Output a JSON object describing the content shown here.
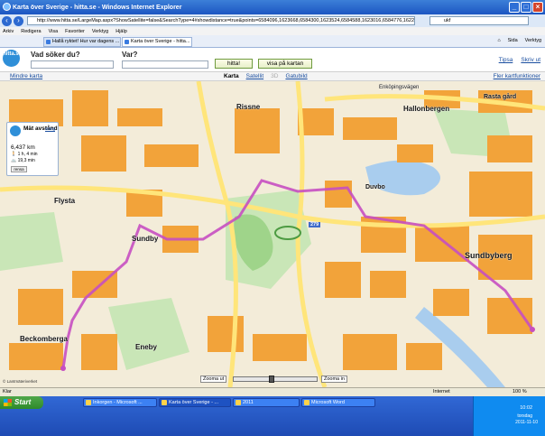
{
  "window": {
    "title": "Karta över Sverige - hitta.se - Windows Internet Explorer",
    "min": "_",
    "max": "□",
    "close": "×"
  },
  "address": {
    "url": "http://www.hitta.se/LargeMap.aspx?ShowSatellite=false&SearchType=4#showdistance=true&points=6584096,1623668,6584300,1623524,6584588,1623016,6584776,1622800",
    "search": "ukf"
  },
  "menu": [
    "Arkiv",
    "Redigera",
    "Visa",
    "Favoriter",
    "Verktyg",
    "Hjälp"
  ],
  "tabs": [
    "Hallå ryktet! Hur var dagens ...",
    "Karta över Sverige - hitta..."
  ],
  "commands": [
    "Sida",
    "Verktyg"
  ],
  "site": {
    "logo": "hitta.se",
    "what_label": "Vad söker du?",
    "where_label": "Var?",
    "search_button": "hitta!",
    "map_button": "visa på kartan",
    "links": [
      "Tipsa",
      "Skriv ut"
    ]
  },
  "maptoolbar": {
    "smaller": "Mindre karta",
    "tabs": [
      "Karta",
      "Satellit",
      "3D",
      "Gatubild"
    ],
    "more": "Fler kartfunktioner"
  },
  "distance_panel": {
    "title": "Mät avstånd",
    "close": "stäng",
    "km": "6,437 km",
    "walk": "1 h, 4 min",
    "bike": "19,3 min",
    "clear": "rensa"
  },
  "map_labels": {
    "rissne": "Rissne",
    "hallonbergen": "Hallonbergen",
    "sundbyberg": "Sundbyberg",
    "sundby": "Sundby",
    "flysta": "Flysta",
    "beckomberga": "Beckomberga",
    "eneby": "Eneby",
    "duvbo": "Duvbo",
    "rasta_gard": "Rasta gård",
    "enkopingsvagen": "Enköpingsvägen",
    "road_number": "279",
    "copyright": "© Lantmäteriverket"
  },
  "zoom": {
    "out": "Zooma ut",
    "in": "Zooma in",
    "level": 0.45
  },
  "status": {
    "ready": "Klar",
    "zone": "Internet",
    "zoom": "100 %"
  },
  "taskbar": {
    "start": "Start",
    "tasks": [
      "Inkorgen - Microsoft ...",
      "Karta över Sverige - ...",
      "2011",
      "Microsoft Word"
    ],
    "time": "10:02",
    "day": "torsdag",
    "date": "2011-11-10"
  },
  "colors": {
    "route": "#c64fc1",
    "buildings": "#f2a33a",
    "park": "#9fd48a",
    "water": "#a9cdee",
    "roads": "#ffe57a"
  }
}
